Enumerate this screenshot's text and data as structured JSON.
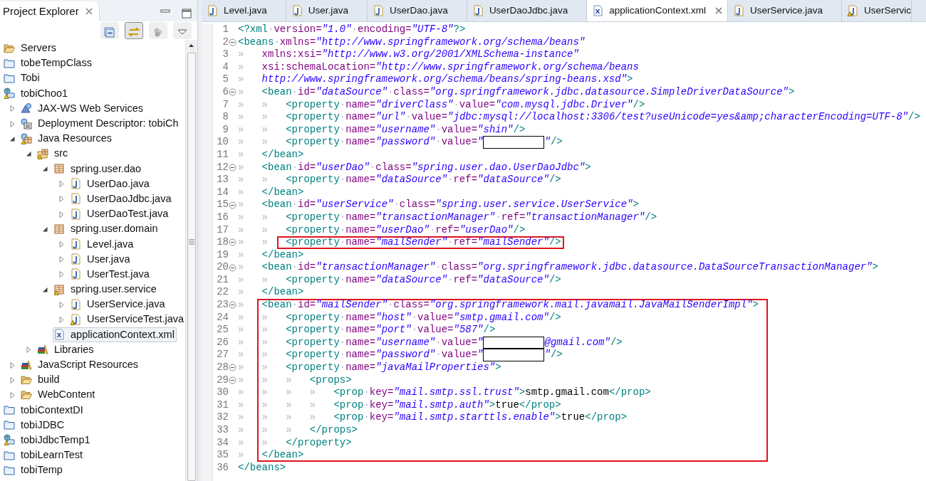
{
  "explorer": {
    "title": "Project Explorer",
    "toolbar": [
      {
        "kind": "collapse",
        "pressed": false
      },
      {
        "kind": "link",
        "pressed": true
      },
      {
        "kind": "filter",
        "pressed": false
      },
      {
        "kind": "menu",
        "pressed": false
      }
    ],
    "tree": [
      {
        "label": "Servers",
        "kind": "folder-open",
        "warning": false,
        "selected": false
      },
      {
        "label": "tobeTempClass",
        "kind": "project",
        "warning": false,
        "selected": false
      },
      {
        "label": "Tobi",
        "kind": "project",
        "warning": false,
        "selected": false
      },
      {
        "label": "tobiChoo1",
        "kind": "web-project",
        "warning": true,
        "selected": false,
        "children": [
          {
            "label": "JAX-WS Web Services",
            "kind": "jaxws",
            "warning": false,
            "selected": false,
            "expanded": false
          },
          {
            "label": "Deployment Descriptor: tobiCh",
            "kind": "descriptor",
            "warning": false,
            "selected": false,
            "expanded": false
          },
          {
            "label": "Java Resources",
            "kind": "java-resources",
            "warning": true,
            "selected": false,
            "expanded": true,
            "children": [
              {
                "label": "src",
                "kind": "source-folder",
                "warning": true,
                "selected": false,
                "expanded": true,
                "children": [
                  {
                    "label": "spring.user.dao",
                    "kind": "package",
                    "warning": false,
                    "selected": false,
                    "expanded": true,
                    "children": [
                      {
                        "label": "UserDao.java",
                        "kind": "java-file",
                        "warning": false,
                        "selected": false,
                        "expanded": false
                      },
                      {
                        "label": "UserDaoJdbc.java",
                        "kind": "java-file",
                        "warning": false,
                        "selected": false,
                        "expanded": false
                      },
                      {
                        "label": "UserDaoTest.java",
                        "kind": "java-file",
                        "warning": false,
                        "selected": false,
                        "expanded": false
                      }
                    ]
                  },
                  {
                    "label": "spring.user.domain",
                    "kind": "package",
                    "warning": false,
                    "selected": false,
                    "expanded": true,
                    "children": [
                      {
                        "label": "Level.java",
                        "kind": "java-file",
                        "warning": false,
                        "selected": false,
                        "expanded": false
                      },
                      {
                        "label": "User.java",
                        "kind": "java-file",
                        "warning": false,
                        "selected": false,
                        "expanded": false
                      },
                      {
                        "label": "UserTest.java",
                        "kind": "java-file",
                        "warning": false,
                        "selected": false,
                        "expanded": false
                      }
                    ]
                  },
                  {
                    "label": "spring.user.service",
                    "kind": "package",
                    "warning": true,
                    "selected": false,
                    "expanded": true,
                    "children": [
                      {
                        "label": "UserService.java",
                        "kind": "java-file",
                        "warning": false,
                        "selected": false,
                        "expanded": false
                      },
                      {
                        "label": "UserServiceTest.java",
                        "kind": "java-file",
                        "warning": true,
                        "selected": false,
                        "expanded": false
                      }
                    ]
                  },
                  {
                    "label": "applicationContext.xml",
                    "kind": "xml-file",
                    "warning": false,
                    "selected": true
                  }
                ]
              },
              {
                "label": "Libraries",
                "kind": "library",
                "warning": false,
                "selected": false,
                "expanded": false
              }
            ]
          },
          {
            "label": "JavaScript Resources",
            "kind": "library",
            "warning": false,
            "selected": false,
            "expanded": false
          },
          {
            "label": "build",
            "kind": "folder-open",
            "warning": false,
            "selected": false,
            "expanded": false
          },
          {
            "label": "WebContent",
            "kind": "folder-open",
            "warning": false,
            "selected": false,
            "expanded": false
          }
        ]
      },
      {
        "label": "tobiContextDI",
        "kind": "project",
        "warning": false,
        "selected": false
      },
      {
        "label": "tobiJDBC",
        "kind": "project",
        "warning": false,
        "selected": false
      },
      {
        "label": "tobiJdbcTemp1",
        "kind": "web-project",
        "warning": true,
        "selected": false
      },
      {
        "label": "tobiLearnTest",
        "kind": "project",
        "warning": false,
        "selected": false
      },
      {
        "label": "tobiTemp",
        "kind": "project",
        "warning": false,
        "selected": false
      }
    ]
  },
  "editor_tabs": [
    {
      "label": "Level.java",
      "kind": "java",
      "warning": false,
      "selected": false
    },
    {
      "label": "User.java",
      "kind": "java",
      "warning": false,
      "selected": false
    },
    {
      "label": "UserDao.java",
      "kind": "java",
      "warning": false,
      "selected": false
    },
    {
      "label": "UserDaoJdbc.java",
      "kind": "java",
      "warning": false,
      "selected": false
    },
    {
      "label": "applicationContext.xml",
      "kind": "xml",
      "warning": false,
      "selected": true
    },
    {
      "label": "UserService.java",
      "kind": "java",
      "warning": false,
      "selected": false
    },
    {
      "label": "UserServic",
      "kind": "java",
      "warning": true,
      "selected": false
    }
  ],
  "lines": [
    {
      "number": "1",
      "foldable": false,
      "boxed": false,
      "segments": [
        {
          "kind": "tag",
          "text": "<?xml"
        },
        {
          "kind": "sp",
          "text": "·"
        },
        {
          "kind": "attr",
          "text": "version="
        },
        {
          "kind": "val",
          "text": "\"1.0\""
        },
        {
          "kind": "sp",
          "text": "·"
        },
        {
          "kind": "attr",
          "text": "encoding="
        },
        {
          "kind": "val",
          "text": "\"UTF-8\""
        },
        {
          "kind": "tag",
          "text": "?>"
        }
      ]
    },
    {
      "number": "2",
      "foldable": true,
      "boxed": false,
      "segments": [
        {
          "kind": "tag",
          "text": "<beans"
        },
        {
          "kind": "sp",
          "text": "·"
        },
        {
          "kind": "attr",
          "text": "xmlns="
        },
        {
          "kind": "val",
          "text": "\"http://www.springframework.org/schema/beans\""
        }
      ]
    },
    {
      "number": "3",
      "foldable": false,
      "boxed": false,
      "segments": [
        {
          "kind": "tab",
          "text": "»"
        },
        {
          "kind": "attr",
          "text": "xmlns:xsi="
        },
        {
          "kind": "val",
          "text": "\"http://www.w3.org/2001/XMLSchema-instance\""
        }
      ]
    },
    {
      "number": "4",
      "foldable": false,
      "boxed": false,
      "segments": [
        {
          "kind": "tab",
          "text": "»"
        },
        {
          "kind": "attr",
          "text": "xsi:schemaLocation="
        },
        {
          "kind": "val",
          "text": "\"http://www.springframework.org/schema/beans"
        }
      ]
    },
    {
      "number": "5",
      "foldable": false,
      "boxed": false,
      "segments": [
        {
          "kind": "tab",
          "text": "»"
        },
        {
          "kind": "val",
          "text": "http://www.springframework.org/schema/beans/spring-beans.xsd\""
        },
        {
          "kind": "tag",
          "text": ">"
        }
      ]
    },
    {
      "number": "6",
      "foldable": true,
      "boxed": false,
      "segments": [
        {
          "kind": "tab",
          "text": "»"
        },
        {
          "kind": "tag",
          "text": "<bean"
        },
        {
          "kind": "sp",
          "text": "·"
        },
        {
          "kind": "attr",
          "text": "id="
        },
        {
          "kind": "val",
          "text": "\"dataSource\""
        },
        {
          "kind": "sp",
          "text": "·"
        },
        {
          "kind": "attr",
          "text": "class="
        },
        {
          "kind": "val",
          "text": "\"org.springframework.jdbc.datasource.SimpleDriverDataSource\""
        },
        {
          "kind": "tag",
          "text": ">"
        }
      ]
    },
    {
      "number": "7",
      "foldable": false,
      "boxed": false,
      "segments": [
        {
          "kind": "tab",
          "text": "»"
        },
        {
          "kind": "tab",
          "text": "»"
        },
        {
          "kind": "tag",
          "text": "<property"
        },
        {
          "kind": "sp",
          "text": "·"
        },
        {
          "kind": "attr",
          "text": "name="
        },
        {
          "kind": "val",
          "text": "\"driverClass\""
        },
        {
          "kind": "sp",
          "text": "·"
        },
        {
          "kind": "attr",
          "text": "value="
        },
        {
          "kind": "val",
          "text": "\"com.mysql.jdbc.Driver\""
        },
        {
          "kind": "tag",
          "text": "/>"
        }
      ]
    },
    {
      "number": "8",
      "foldable": false,
      "boxed": false,
      "segments": [
        {
          "kind": "tab",
          "text": "»"
        },
        {
          "kind": "tab",
          "text": "»"
        },
        {
          "kind": "tag",
          "text": "<property"
        },
        {
          "kind": "sp",
          "text": "·"
        },
        {
          "kind": "attr",
          "text": "name="
        },
        {
          "kind": "val",
          "text": "\"url\""
        },
        {
          "kind": "sp",
          "text": "·"
        },
        {
          "kind": "attr",
          "text": "value="
        },
        {
          "kind": "val",
          "text": "\"jdbc:mysql://localhost:3306/test?useUnicode=yes&amp;characterEncoding=UTF-8\""
        },
        {
          "kind": "tag",
          "text": "/>"
        }
      ]
    },
    {
      "number": "9",
      "foldable": false,
      "boxed": false,
      "segments": [
        {
          "kind": "tab",
          "text": "»"
        },
        {
          "kind": "tab",
          "text": "»"
        },
        {
          "kind": "tag",
          "text": "<property"
        },
        {
          "kind": "sp",
          "text": "·"
        },
        {
          "kind": "attr",
          "text": "name="
        },
        {
          "kind": "val",
          "text": "\"username\""
        },
        {
          "kind": "sp",
          "text": "·"
        },
        {
          "kind": "attr",
          "text": "value="
        },
        {
          "kind": "val",
          "text": "\"shin\""
        },
        {
          "kind": "tag",
          "text": "/>"
        }
      ]
    },
    {
      "number": "10",
      "foldable": false,
      "boxed": false,
      "segments": [
        {
          "kind": "tab",
          "text": "»"
        },
        {
          "kind": "tab",
          "text": "»"
        },
        {
          "kind": "tag",
          "text": "<property"
        },
        {
          "kind": "sp",
          "text": "·"
        },
        {
          "kind": "attr",
          "text": "name="
        },
        {
          "kind": "val",
          "text": "\"password\""
        },
        {
          "kind": "sp",
          "text": "·"
        },
        {
          "kind": "attr",
          "text": "value="
        },
        {
          "kind": "val",
          "text": "\""
        },
        {
          "kind": "redacted"
        },
        {
          "kind": "val",
          "text": "\""
        },
        {
          "kind": "tag",
          "text": "/>"
        }
      ]
    },
    {
      "number": "11",
      "foldable": false,
      "boxed": false,
      "segments": [
        {
          "kind": "tab",
          "text": "»"
        },
        {
          "kind": "tag",
          "text": "</bean>"
        }
      ]
    },
    {
      "number": "12",
      "foldable": true,
      "boxed": false,
      "segments": [
        {
          "kind": "tab",
          "text": "»"
        },
        {
          "kind": "tag",
          "text": "<bean"
        },
        {
          "kind": "sp",
          "text": "·"
        },
        {
          "kind": "attr",
          "text": "id="
        },
        {
          "kind": "val",
          "text": "\"userDao\""
        },
        {
          "kind": "sp",
          "text": "·"
        },
        {
          "kind": "attr",
          "text": "class="
        },
        {
          "kind": "val",
          "text": "\"spring.user.dao.UserDaoJdbc\""
        },
        {
          "kind": "tag",
          "text": ">"
        }
      ]
    },
    {
      "number": "13",
      "foldable": false,
      "boxed": false,
      "segments": [
        {
          "kind": "tab",
          "text": "»"
        },
        {
          "kind": "tab",
          "text": "»"
        },
        {
          "kind": "tag",
          "text": "<property"
        },
        {
          "kind": "sp",
          "text": "·"
        },
        {
          "kind": "attr",
          "text": "name="
        },
        {
          "kind": "val",
          "text": "\"dataSource\""
        },
        {
          "kind": "sp",
          "text": "·"
        },
        {
          "kind": "attr",
          "text": "ref="
        },
        {
          "kind": "val",
          "text": "\"dataSource\""
        },
        {
          "kind": "tag",
          "text": "/>"
        }
      ]
    },
    {
      "number": "14",
      "foldable": false,
      "boxed": false,
      "segments": [
        {
          "kind": "tab",
          "text": "»"
        },
        {
          "kind": "tag",
          "text": "</bean>"
        }
      ]
    },
    {
      "number": "15",
      "foldable": true,
      "boxed": false,
      "segments": [
        {
          "kind": "tab",
          "text": "»"
        },
        {
          "kind": "tag",
          "text": "<bean"
        },
        {
          "kind": "sp",
          "text": "·"
        },
        {
          "kind": "attr",
          "text": "id="
        },
        {
          "kind": "val",
          "text": "\"userService\""
        },
        {
          "kind": "sp",
          "text": "·"
        },
        {
          "kind": "attr",
          "text": "class="
        },
        {
          "kind": "val",
          "text": "\"spring.user.service.UserService\""
        },
        {
          "kind": "tag",
          "text": ">"
        }
      ]
    },
    {
      "number": "16",
      "foldable": false,
      "boxed": false,
      "segments": [
        {
          "kind": "tab",
          "text": "»"
        },
        {
          "kind": "tab",
          "text": "»"
        },
        {
          "kind": "tag",
          "text": "<property"
        },
        {
          "kind": "sp",
          "text": "·"
        },
        {
          "kind": "attr",
          "text": "name="
        },
        {
          "kind": "val",
          "text": "\"transactionManager\""
        },
        {
          "kind": "sp",
          "text": "·"
        },
        {
          "kind": "attr",
          "text": "ref="
        },
        {
          "kind": "val",
          "text": "\"transactionManager\""
        },
        {
          "kind": "tag",
          "text": "/>"
        }
      ]
    },
    {
      "number": "17",
      "foldable": false,
      "boxed": false,
      "segments": [
        {
          "kind": "tab",
          "text": "»"
        },
        {
          "kind": "tab",
          "text": "»"
        },
        {
          "kind": "tag",
          "text": "<property"
        },
        {
          "kind": "sp",
          "text": "·"
        },
        {
          "kind": "attr",
          "text": "name="
        },
        {
          "kind": "val",
          "text": "\"userDao\""
        },
        {
          "kind": "sp",
          "text": "·"
        },
        {
          "kind": "attr",
          "text": "ref="
        },
        {
          "kind": "val",
          "text": "\"userDao\""
        },
        {
          "kind": "tag",
          "text": "/>"
        }
      ]
    },
    {
      "number": "18",
      "foldable": true,
      "boxed": true,
      "segments": [
        {
          "kind": "tab",
          "text": "»"
        },
        {
          "kind": "tab",
          "text": "»"
        },
        {
          "kind": "tag",
          "text": "<property"
        },
        {
          "kind": "sp",
          "text": "·"
        },
        {
          "kind": "attr",
          "text": "name="
        },
        {
          "kind": "val",
          "text": "\"mailSender\""
        },
        {
          "kind": "sp",
          "text": "·"
        },
        {
          "kind": "attr",
          "text": "ref="
        },
        {
          "kind": "val",
          "text": "\"mailSender\""
        },
        {
          "kind": "tag",
          "text": "/>"
        }
      ]
    },
    {
      "number": "19",
      "foldable": false,
      "boxed": false,
      "segments": [
        {
          "kind": "tab",
          "text": "»"
        },
        {
          "kind": "tag",
          "text": "</bean>"
        }
      ]
    },
    {
      "number": "20",
      "foldable": true,
      "boxed": false,
      "segments": [
        {
          "kind": "tab",
          "text": "»"
        },
        {
          "kind": "tag",
          "text": "<bean"
        },
        {
          "kind": "sp",
          "text": "·"
        },
        {
          "kind": "attr",
          "text": "id="
        },
        {
          "kind": "val",
          "text": "\"transactionManager\""
        },
        {
          "kind": "sp",
          "text": "·"
        },
        {
          "kind": "attr",
          "text": "class="
        },
        {
          "kind": "val",
          "text": "\"org.springframework.jdbc.datasource.DataSourceTransactionManager\""
        },
        {
          "kind": "tag",
          "text": ">"
        }
      ]
    },
    {
      "number": "21",
      "foldable": false,
      "boxed": false,
      "segments": [
        {
          "kind": "tab",
          "text": "»"
        },
        {
          "kind": "tab",
          "text": "»"
        },
        {
          "kind": "tag",
          "text": "<property"
        },
        {
          "kind": "sp",
          "text": "·"
        },
        {
          "kind": "attr",
          "text": "name="
        },
        {
          "kind": "val",
          "text": "\"dataSource\""
        },
        {
          "kind": "sp",
          "text": "·"
        },
        {
          "kind": "attr",
          "text": "ref="
        },
        {
          "kind": "val",
          "text": "\"dataSource\""
        },
        {
          "kind": "tag",
          "text": "/>"
        }
      ]
    },
    {
      "number": "22",
      "foldable": false,
      "boxed": false,
      "segments": [
        {
          "kind": "tab",
          "text": "»"
        },
        {
          "kind": "tag",
          "text": "</bean>"
        }
      ]
    },
    {
      "number": "23",
      "foldable": true,
      "boxed": true,
      "segments": [
        {
          "kind": "tab",
          "text": "»"
        },
        {
          "kind": "tag",
          "text": "<bean"
        },
        {
          "kind": "sp",
          "text": "·"
        },
        {
          "kind": "attr",
          "text": "id="
        },
        {
          "kind": "val",
          "text": "\"mailSender\""
        },
        {
          "kind": "sp",
          "text": "·"
        },
        {
          "kind": "attr",
          "text": "class="
        },
        {
          "kind": "val",
          "text": "\"org.springframework.mail.javamail.JavaMailSenderImpl\""
        },
        {
          "kind": "tag",
          "text": ">"
        }
      ]
    },
    {
      "number": "24",
      "foldable": false,
      "boxed": true,
      "segments": [
        {
          "kind": "tab",
          "text": "»"
        },
        {
          "kind": "tab",
          "text": "»"
        },
        {
          "kind": "tag",
          "text": "<property"
        },
        {
          "kind": "sp",
          "text": "·"
        },
        {
          "kind": "attr",
          "text": "name="
        },
        {
          "kind": "val",
          "text": "\"host\""
        },
        {
          "kind": "sp",
          "text": "·"
        },
        {
          "kind": "attr",
          "text": "value="
        },
        {
          "kind": "val",
          "text": "\"smtp.gmail.com\""
        },
        {
          "kind": "tag",
          "text": "/>"
        }
      ]
    },
    {
      "number": "25",
      "foldable": false,
      "boxed": true,
      "segments": [
        {
          "kind": "tab",
          "text": "»"
        },
        {
          "kind": "tab",
          "text": "»"
        },
        {
          "kind": "tag",
          "text": "<property"
        },
        {
          "kind": "sp",
          "text": "·"
        },
        {
          "kind": "attr",
          "text": "name="
        },
        {
          "kind": "val",
          "text": "\"port\""
        },
        {
          "kind": "sp",
          "text": "·"
        },
        {
          "kind": "attr",
          "text": "value="
        },
        {
          "kind": "val",
          "text": "\"587\""
        },
        {
          "kind": "tag",
          "text": "/>"
        }
      ]
    },
    {
      "number": "26",
      "foldable": false,
      "boxed": true,
      "segments": [
        {
          "kind": "tab",
          "text": "»"
        },
        {
          "kind": "tab",
          "text": "»"
        },
        {
          "kind": "tag",
          "text": "<property"
        },
        {
          "kind": "sp",
          "text": "·"
        },
        {
          "kind": "attr",
          "text": "name="
        },
        {
          "kind": "val",
          "text": "\"username\""
        },
        {
          "kind": "sp",
          "text": "·"
        },
        {
          "kind": "attr",
          "text": "value="
        },
        {
          "kind": "val",
          "text": "\""
        },
        {
          "kind": "redacted"
        },
        {
          "kind": "val",
          "text": "@gmail.com\""
        },
        {
          "kind": "tag",
          "text": "/>"
        }
      ]
    },
    {
      "number": "27",
      "foldable": false,
      "boxed": true,
      "segments": [
        {
          "kind": "tab",
          "text": "»"
        },
        {
          "kind": "tab",
          "text": "»"
        },
        {
          "kind": "tag",
          "text": "<property"
        },
        {
          "kind": "sp",
          "text": "·"
        },
        {
          "kind": "attr",
          "text": "name="
        },
        {
          "kind": "val",
          "text": "\"password\""
        },
        {
          "kind": "sp",
          "text": "·"
        },
        {
          "kind": "attr",
          "text": "value="
        },
        {
          "kind": "val",
          "text": "\""
        },
        {
          "kind": "redacted"
        },
        {
          "kind": "val",
          "text": "\""
        },
        {
          "kind": "tag",
          "text": "/>"
        }
      ]
    },
    {
      "number": "28",
      "foldable": true,
      "boxed": true,
      "segments": [
        {
          "kind": "tab",
          "text": "»"
        },
        {
          "kind": "tab",
          "text": "»"
        },
        {
          "kind": "tag",
          "text": "<property"
        },
        {
          "kind": "sp",
          "text": "·"
        },
        {
          "kind": "attr",
          "text": "name="
        },
        {
          "kind": "val",
          "text": "\"javaMailProperties\""
        },
        {
          "kind": "tag",
          "text": ">"
        }
      ]
    },
    {
      "number": "29",
      "foldable": true,
      "boxed": true,
      "segments": [
        {
          "kind": "tab",
          "text": "»"
        },
        {
          "kind": "tab",
          "text": "»"
        },
        {
          "kind": "tab",
          "text": "»"
        },
        {
          "kind": "tag",
          "text": "<props>"
        }
      ]
    },
    {
      "number": "30",
      "foldable": false,
      "boxed": true,
      "segments": [
        {
          "kind": "tab",
          "text": "»"
        },
        {
          "kind": "tab",
          "text": "»"
        },
        {
          "kind": "tab",
          "text": "»"
        },
        {
          "kind": "tab",
          "text": "»"
        },
        {
          "kind": "tag",
          "text": "<prop"
        },
        {
          "kind": "sp",
          "text": "·"
        },
        {
          "kind": "attr",
          "text": "key="
        },
        {
          "kind": "val",
          "text": "\"mail.smtp.ssl.trust\""
        },
        {
          "kind": "tag",
          "text": ">"
        },
        {
          "kind": "txt",
          "text": "smtp.gmail.com"
        },
        {
          "kind": "tag",
          "text": "</prop>"
        }
      ]
    },
    {
      "number": "31",
      "foldable": false,
      "boxed": true,
      "segments": [
        {
          "kind": "tab",
          "text": "»"
        },
        {
          "kind": "tab",
          "text": "»"
        },
        {
          "kind": "tab",
          "text": "»"
        },
        {
          "kind": "tab",
          "text": "»"
        },
        {
          "kind": "tag",
          "text": "<prop"
        },
        {
          "kind": "sp",
          "text": "·"
        },
        {
          "kind": "attr",
          "text": "key="
        },
        {
          "kind": "val",
          "text": "\"mail.smtp.auth\""
        },
        {
          "kind": "tag",
          "text": ">"
        },
        {
          "kind": "txt",
          "text": "true"
        },
        {
          "kind": "tag",
          "text": "</prop>"
        }
      ]
    },
    {
      "number": "32",
      "foldable": false,
      "boxed": true,
      "segments": [
        {
          "kind": "tab",
          "text": "»"
        },
        {
          "kind": "tab",
          "text": "»"
        },
        {
          "kind": "tab",
          "text": "»"
        },
        {
          "kind": "tab",
          "text": "»"
        },
        {
          "kind": "tag",
          "text": "<prop"
        },
        {
          "kind": "sp",
          "text": "·"
        },
        {
          "kind": "attr",
          "text": "key="
        },
        {
          "kind": "val",
          "text": "\"mail.smtp.starttls.enable\""
        },
        {
          "kind": "tag",
          "text": ">"
        },
        {
          "kind": "txt",
          "text": "true"
        },
        {
          "kind": "tag",
          "text": "</prop>"
        }
      ]
    },
    {
      "number": "33",
      "foldable": false,
      "boxed": true,
      "segments": [
        {
          "kind": "tab",
          "text": "»"
        },
        {
          "kind": "tab",
          "text": "»"
        },
        {
          "kind": "tab",
          "text": "»"
        },
        {
          "kind": "tag",
          "text": "</props>"
        }
      ]
    },
    {
      "number": "34",
      "foldable": false,
      "boxed": true,
      "segments": [
        {
          "kind": "tab",
          "text": "»"
        },
        {
          "kind": "tab",
          "text": "»"
        },
        {
          "kind": "tag",
          "text": "</property>"
        }
      ]
    },
    {
      "number": "35",
      "foldable": false,
      "boxed": true,
      "segments": [
        {
          "kind": "tab",
          "text": "»"
        },
        {
          "kind": "tag",
          "text": "</bean>"
        }
      ]
    },
    {
      "number": "36",
      "foldable": false,
      "boxed": false,
      "segments": [
        {
          "kind": "tag",
          "text": "</beans>"
        }
      ]
    }
  ]
}
